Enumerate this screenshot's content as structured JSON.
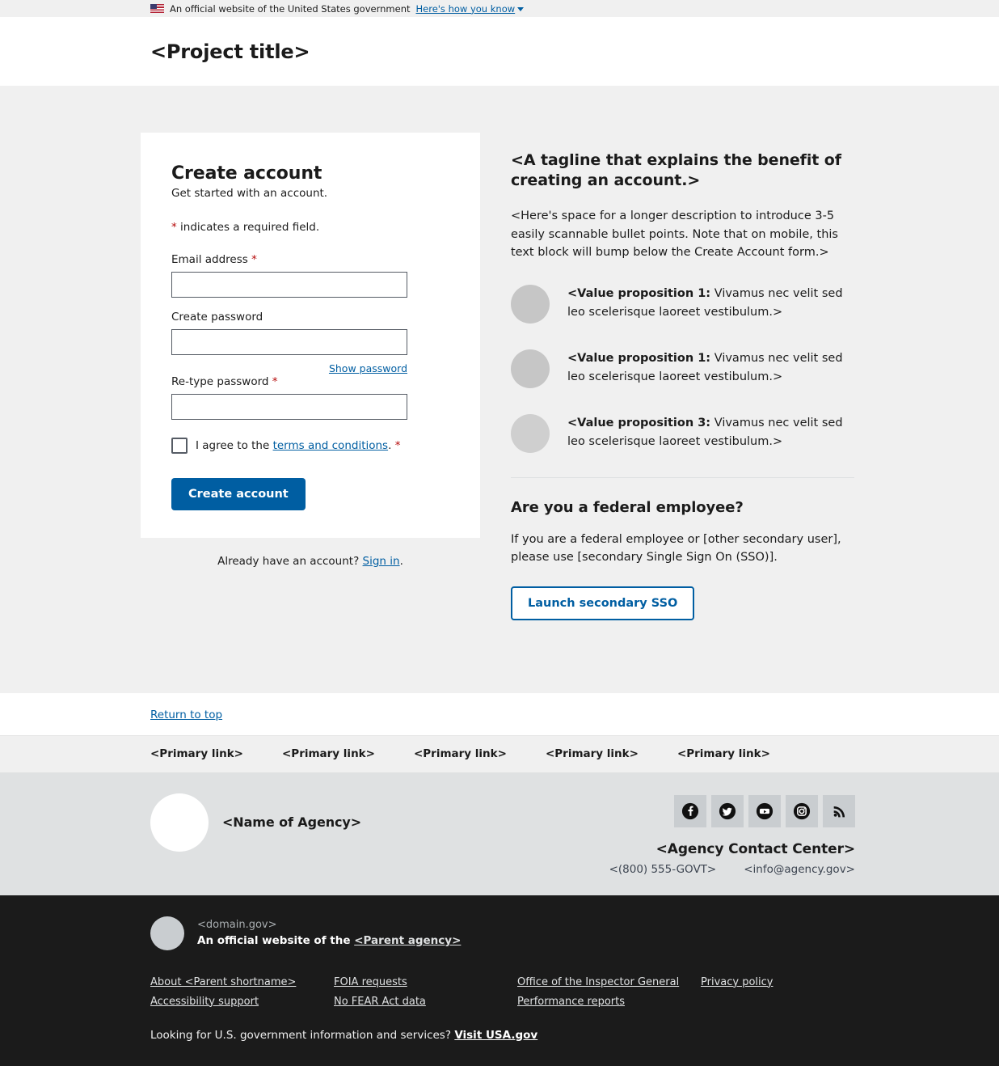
{
  "gov_banner": {
    "flag_icon": "us-flag-icon",
    "text": "An official website of the United States government",
    "link_label": "Here's how you know",
    "chevron_icon": "chevron-down-icon"
  },
  "header": {
    "project_title": "<Project title>"
  },
  "form": {
    "title": "Create account",
    "subtitle": "Get started with an account.",
    "required_note_star": "*",
    "required_note": " indicates a required field.",
    "email_label": "Email address ",
    "email_value": "",
    "email_placeholder": "",
    "password_label": "Create password",
    "password_value": "",
    "show_password_label": "Show password",
    "retype_label": "Re-type password ",
    "retype_value": "",
    "terms_prefix": "I agree to the ",
    "terms_link": "terms and conditions",
    "terms_suffix": ". ",
    "terms_checked": false,
    "submit_label": "Create account",
    "submit_color": "#005ea2",
    "signin_prefix": "Already have an account? ",
    "signin_link": "Sign in",
    "signin_suffix": "."
  },
  "benefits": {
    "tagline": "<A tagline that explains the benefit of creating an account.>",
    "lede": "<Here's space for a longer description to introduce 3-5 easily scannable bullet points. Note that on mobile, this text block will bump below the Create Account form.>",
    "items": [
      {
        "icon": "placeholder-circle-icon",
        "bold": "<Value proposition 1:",
        "rest": " Vivamus nec velit sed leo scelerisque laoreet vestibulum.>"
      },
      {
        "icon": "placeholder-circle-icon",
        "bold": "<Value proposition 1:",
        "rest": " Vivamus nec velit sed leo scelerisque laoreet vestibulum.>"
      },
      {
        "icon": "placeholder-circle-icon",
        "bold": "<Value proposition 3:",
        "rest": " Vivamus nec velit sed leo scelerisque laoreet vestibulum.>"
      }
    ]
  },
  "federal": {
    "title": "Are you a federal employee?",
    "text": "If you are a federal employee or [other secondary user], please use [secondary Single Sign On (SSO)].",
    "button_label": "Launch secondary SSO",
    "button_color": "#005ea2"
  },
  "return_to_top": {
    "label": "Return to top"
  },
  "primary_nav": {
    "links": [
      "<Primary link>",
      "<Primary link>",
      "<Primary link>",
      "<Primary link>",
      "<Primary link>"
    ]
  },
  "agency_footer": {
    "logo_icon": "agency-seal-placeholder-icon",
    "agency_name": "<Name of Agency>",
    "social": [
      {
        "icon": "facebook-icon",
        "label": "Facebook"
      },
      {
        "icon": "twitter-icon",
        "label": "Twitter"
      },
      {
        "icon": "youtube-icon",
        "label": "YouTube"
      },
      {
        "icon": "instagram-icon",
        "label": "Instagram"
      },
      {
        "icon": "rss-icon",
        "label": "RSS"
      }
    ],
    "contact_title": "<Agency Contact Center>",
    "phone": "<(800) 555-GOVT>",
    "email": "<info@agency.gov>"
  },
  "identifier": {
    "logo_icon": "parent-agency-seal-placeholder-icon",
    "domain": "<domain.gov>",
    "official_prefix": "An official website of the ",
    "parent_agency_link": "<Parent agency>",
    "link_columns": [
      [
        "About <Parent shortname>",
        "Accessibility support"
      ],
      [
        "FOIA requests",
        "No FEAR Act data"
      ],
      [
        "Office of the Inspector General",
        "Performance reports"
      ],
      [
        "Privacy policy"
      ]
    ],
    "usagov_prefix": "Looking for U.S. government information and services? ",
    "usagov_link": "Visit USA.gov"
  }
}
